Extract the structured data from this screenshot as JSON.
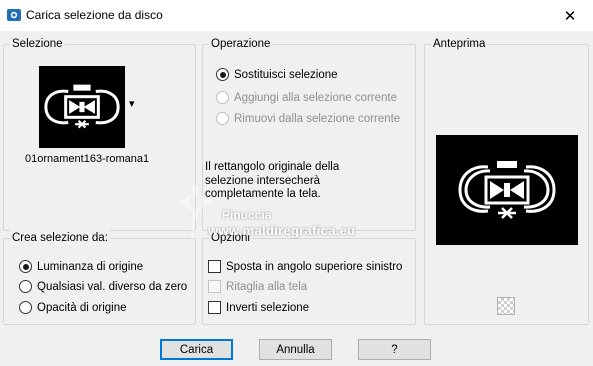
{
  "window": {
    "title": "Carica selezione da disco",
    "close_glyph": "✕"
  },
  "selezione": {
    "label": "Selezione",
    "filename": "01ornament163-romana1",
    "dropdown_glyph": "▾"
  },
  "operazione": {
    "label": "Operazione",
    "options": [
      {
        "label": "Sostituisci selezione",
        "checked": true,
        "enabled": true
      },
      {
        "label": "Aggiungi alla selezione corrente",
        "checked": false,
        "enabled": false
      },
      {
        "label": "Rimuovi dalla selezione corrente",
        "checked": false,
        "enabled": false
      }
    ],
    "info_text_1": "Il rettangolo originale della",
    "info_text_2": "selezione intersecherà",
    "info_text_3": "completamente la tela."
  },
  "anteprima": {
    "label": "Anteprima"
  },
  "crea": {
    "label": "Crea selezione da:",
    "options": [
      {
        "label": "Luminanza di origine",
        "checked": true
      },
      {
        "label": "Qualsiasi val. diverso da zero",
        "checked": false
      },
      {
        "label": "Opacità di origine",
        "checked": false
      }
    ]
  },
  "opzioni": {
    "label": "Opzioni",
    "options": [
      {
        "label": "Sposta in angolo superiore sinistro",
        "checked": false,
        "enabled": true
      },
      {
        "label": "Ritaglia alla tela",
        "checked": false,
        "enabled": false
      },
      {
        "label": "Inverti selezione",
        "checked": false,
        "enabled": true
      }
    ]
  },
  "buttons": {
    "ok": "Carica",
    "cancel": "Annulla",
    "help": "?"
  },
  "watermark": {
    "line1": "Pinuccia",
    "line2": "www.maldiregrafica.eu"
  },
  "colors": {
    "window_bg": "#f0f0f0",
    "accent": "#0078d7"
  }
}
